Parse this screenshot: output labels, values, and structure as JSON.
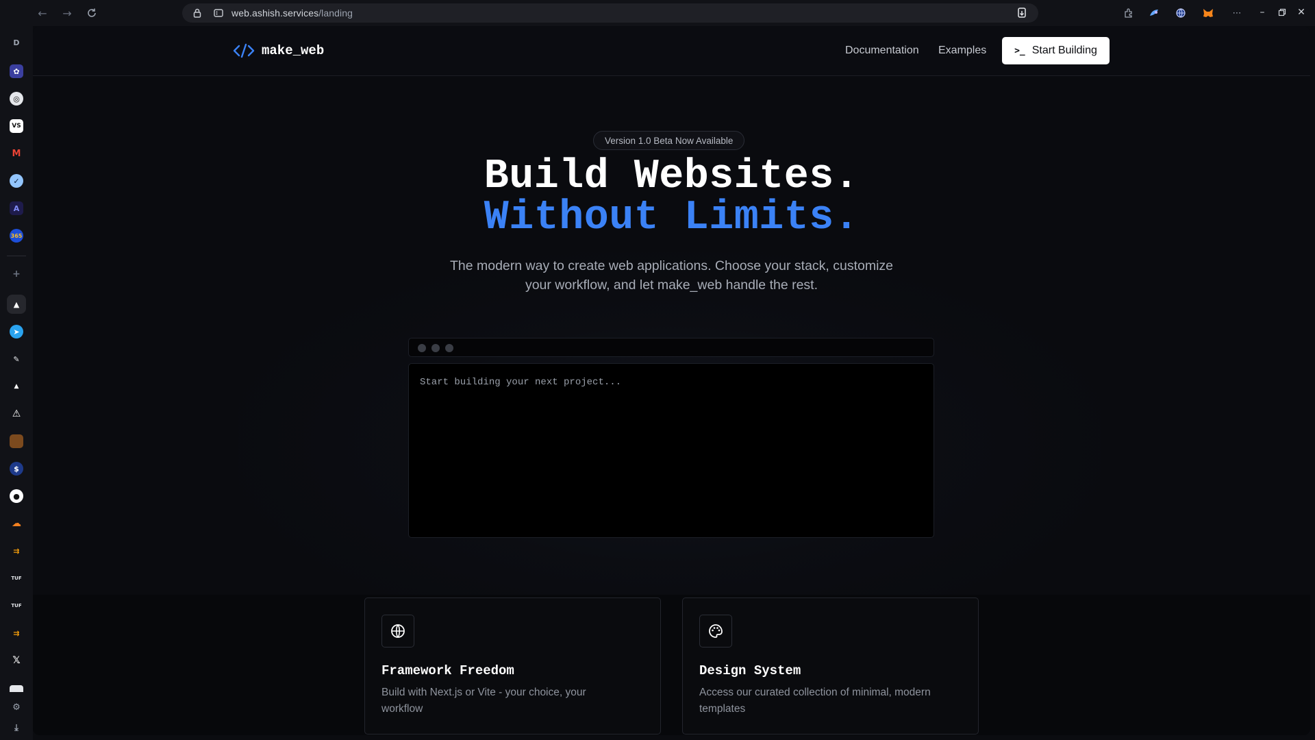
{
  "browser": {
    "url_host": "web.ashish.services",
    "url_path": "/landing",
    "toolbar_icons": [
      "back-icon",
      "forward-icon",
      "reload-icon",
      "lock-icon",
      "site-settings-icon",
      "install-app-icon",
      "extensions-icon",
      "copilot-icon",
      "vpn-globe-icon",
      "metamask-icon",
      "more-icon"
    ],
    "window_controls": [
      "minimize-icon",
      "restore-icon",
      "close-icon"
    ]
  },
  "sidebar": {
    "profile_label": "D",
    "apps": [
      {
        "name": "chatgpt-app",
        "color": "#9aa6ff"
      },
      {
        "name": "app-2",
        "color": "#e5e7eb"
      },
      {
        "name": "vscode-web-app",
        "color": "#ffffff"
      },
      {
        "name": "gmail-app",
        "color": "#ea4335"
      },
      {
        "name": "tasks-app",
        "color": "#93c5fd"
      },
      {
        "name": "translate-app",
        "color": "#6366f1"
      },
      {
        "name": "app-7",
        "color": "#f59e0b"
      },
      {
        "name": "vercel-app",
        "color": "#ffffff"
      },
      {
        "name": "telegram-app",
        "color": "#2aa3ef"
      },
      {
        "name": "pen-app",
        "color": "#e5e7eb"
      },
      {
        "name": "triangle-app",
        "color": "#ffffff"
      },
      {
        "name": "warning-app",
        "color": "#ffffff"
      },
      {
        "name": "notes-app",
        "color": "#a16207"
      },
      {
        "name": "finance-app",
        "color": "#3b82f6"
      },
      {
        "name": "github-app",
        "color": "#ffffff"
      },
      {
        "name": "cloudflare-app",
        "color": "#f38020"
      },
      {
        "name": "arrow-app-1",
        "color": "#f59e0b"
      },
      {
        "name": "tuf-app-1",
        "color": "#e5e7eb"
      },
      {
        "name": "tuf-app-2",
        "color": "#e5e7eb"
      },
      {
        "name": "arrow-app-2",
        "color": "#f59e0b"
      },
      {
        "name": "x-app",
        "color": "#ffffff"
      },
      {
        "name": "app-22",
        "color": "#e5e7eb"
      }
    ]
  },
  "nav": {
    "brand": "make_web",
    "links": [
      "Documentation",
      "Examples"
    ],
    "cta": "Start Building",
    "accent": "#3b82f6"
  },
  "hero": {
    "badge": "Version 1.0 Beta Now Available",
    "line1": "Build Websites.",
    "line2": "Without Limits.",
    "subtitle_1": "The modern way to create web applications. Choose your stack, customize",
    "subtitle_2": "your workflow, and let make_web handle the rest."
  },
  "terminal": {
    "placeholder": "Start building your next project..."
  },
  "features": [
    {
      "icon": "globe-icon",
      "title": "Framework Freedom",
      "desc": "Build with Next.js or Vite - your choice, your workflow"
    },
    {
      "icon": "palette-icon",
      "title": "Design System",
      "desc": "Access our curated collection of minimal, modern templates"
    }
  ]
}
